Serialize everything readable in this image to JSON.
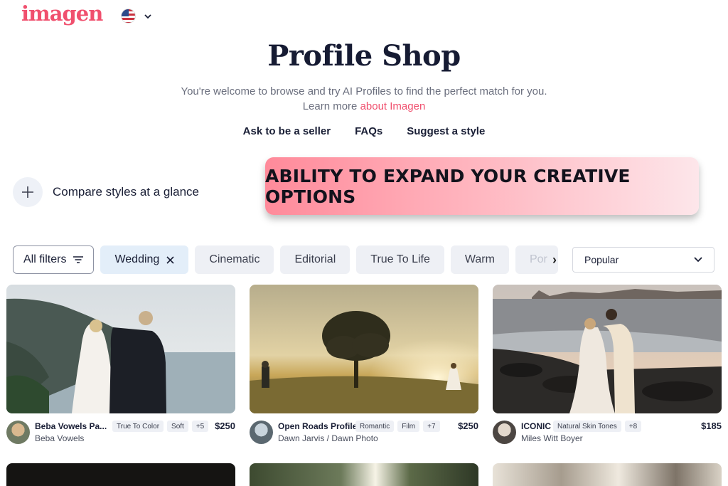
{
  "brand": {
    "logo_text": "imagen",
    "logo_color": "#f0506e"
  },
  "language": {
    "icon": "us-flag-icon"
  },
  "hero": {
    "title": "Profile Shop",
    "subtitle_line1": "You're welcome to browse and try AI Profiles to find the perfect match for you.",
    "subtitle_line2_prefix": "Learn more ",
    "subtitle_link": "about Imagen"
  },
  "nav_links": [
    "Ask to be a seller",
    "FAQs",
    "Suggest a style"
  ],
  "compare": {
    "label": "Compare styles at a glance",
    "icon": "plus-icon"
  },
  "banner": {
    "text": "ABILITY TO EXPAND YOUR CREATIVE OPTIONS"
  },
  "filters": {
    "all_filters_label": "All filters",
    "chips": [
      "Wedding",
      "Cinematic",
      "Editorial",
      "True To Life",
      "Warm",
      "Por"
    ],
    "active_chip": "Wedding"
  },
  "sort": {
    "selected": "Popular"
  },
  "cards": [
    {
      "name": "Beba Vowels Pa...",
      "author": "Beba Vowels",
      "tags": [
        "True To Color",
        "Soft",
        "+5"
      ],
      "price": "$250"
    },
    {
      "name": "Open Roads Profile",
      "author": "Dawn Jarvis / Dawn Photo",
      "tags": [
        "Romantic",
        "Film",
        "+7"
      ],
      "price": "$250"
    },
    {
      "name": "ICONIC",
      "author": "Miles Witt Boyer",
      "tags": [
        "Natural Skin Tones",
        "+8"
      ],
      "price": "$185"
    }
  ],
  "colors": {
    "accent": "#f0506e",
    "heading": "#161b33",
    "chip_bg": "#eef0f5",
    "active_chip_bg": "#e3eef9"
  }
}
